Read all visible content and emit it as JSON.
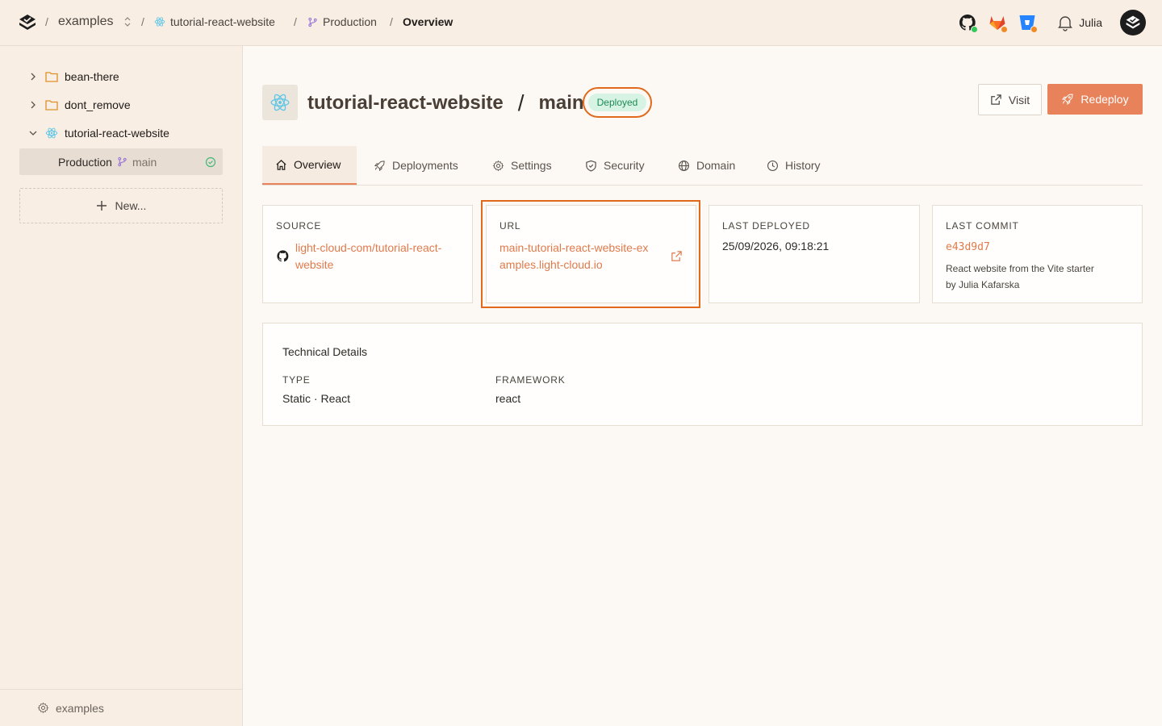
{
  "topbar": {
    "breadcrumb": {
      "org": "examples",
      "separator": "/",
      "project": "tutorial-react-website",
      "environment": "Production",
      "page": "Overview"
    },
    "integrations": [
      "github-icon",
      "gitlab-icon",
      "bitbucket-icon"
    ],
    "user": {
      "name": "Julia"
    }
  },
  "sidebar": {
    "items": [
      {
        "label": "bean-there",
        "icon": "folder-icon",
        "expanded": false
      },
      {
        "label": "dont_remove",
        "icon": "folder-icon",
        "expanded": false
      },
      {
        "label": "tutorial-react-website",
        "icon": "react-icon",
        "expanded": true
      }
    ],
    "selected": {
      "environment": "Production",
      "branch": "main",
      "status": "ok"
    },
    "new_label": "New...",
    "footer_label": "examples"
  },
  "header": {
    "project": "tutorial-react-website",
    "separator": "/",
    "branch": "main",
    "status": "Deployed",
    "visit_label": "Visit",
    "redeploy_label": "Redeploy"
  },
  "tabs": [
    {
      "label": "Overview",
      "icon": "home-icon",
      "active": true
    },
    {
      "label": "Deployments",
      "icon": "rocket-icon",
      "active": false
    },
    {
      "label": "Settings",
      "icon": "gear-icon",
      "active": false
    },
    {
      "label": "Security",
      "icon": "shield-icon",
      "active": false
    },
    {
      "label": "Domain",
      "icon": "globe-icon",
      "active": false
    },
    {
      "label": "History",
      "icon": "clock-icon",
      "active": false
    }
  ],
  "cards": {
    "source": {
      "label": "SOURCE",
      "line1": "light-cloud-com/tutorial-react-",
      "line2": "website"
    },
    "url": {
      "label": "URL",
      "line1": "main-tutorial-react-website-ex",
      "line2": "amples.light-cloud.io"
    },
    "deployed": {
      "label": "LAST DEPLOYED",
      "value": "25/09/2026, 09:18:21"
    },
    "commit": {
      "label": "LAST COMMIT",
      "hash": "e43d9d7",
      "message": "React website from the Vite starter",
      "author": "by Julia Kafarska"
    }
  },
  "technical": {
    "title": "Technical Details",
    "type_label": "TYPE",
    "type_value": "Static · React",
    "framework_label": "FRAMEWORK",
    "framework_value": "react"
  },
  "colors": {
    "accent": "#e8825a",
    "highlight": "#e0691c",
    "success": "#1f8a55"
  }
}
